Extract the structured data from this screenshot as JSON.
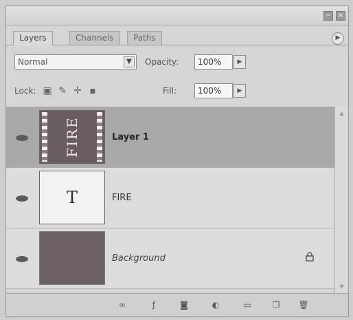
{
  "tabs": [
    {
      "label": "Layers",
      "active": true
    },
    {
      "label": "Channels",
      "active": false
    },
    {
      "label": "Paths",
      "active": false
    }
  ],
  "blend_mode": "Normal",
  "opacity": {
    "label": "Opacity:",
    "value": "100%"
  },
  "lock": {
    "label": "Lock:",
    "icons": [
      "lock-transparent-icon",
      "lock-image-icon",
      "lock-position-icon",
      "lock-all-icon"
    ]
  },
  "fill": {
    "label": "Fill:",
    "value": "100%"
  },
  "layers": [
    {
      "name": "Layer 1",
      "thumb_text": "FIRE",
      "selected": true,
      "visible": true
    },
    {
      "name": "FIRE",
      "thumb_text": "T",
      "selected": false,
      "visible": true
    },
    {
      "name": "Background",
      "selected": false,
      "visible": true,
      "locked": true
    }
  ],
  "footer_icons": [
    "link-icon",
    "add-style-icon",
    "add-mask-icon",
    "adjustment-layer-icon",
    "new-group-icon",
    "new-layer-icon",
    "delete-layer-icon"
  ],
  "colors": {
    "selected_row": "#aaa8a6",
    "panel": "#d7d5d1"
  }
}
